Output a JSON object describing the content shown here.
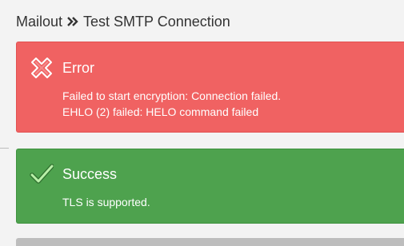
{
  "breadcrumb": {
    "section": "Mailout",
    "separator_icon": "double-chevron-right-icon",
    "page": "Test SMTP Connection"
  },
  "error_panel": {
    "icon": "x-mark-icon",
    "title": "Error",
    "lines": [
      "Failed to start encryption: Connection failed.",
      "EHLO (2) failed: HELO command failed"
    ],
    "background": "#f06262"
  },
  "success_panel": {
    "icon": "checkmark-icon",
    "title": "Success",
    "lines": [
      "TLS is supported."
    ],
    "background": "#4ea24e"
  }
}
